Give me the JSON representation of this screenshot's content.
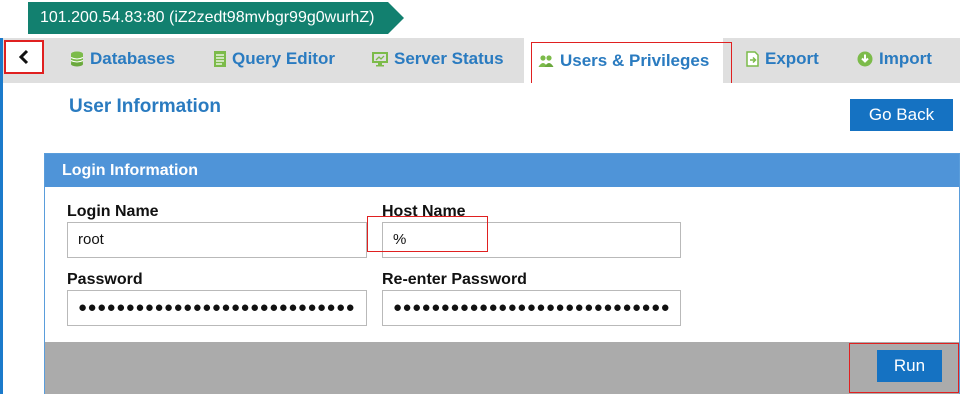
{
  "connection": {
    "label": "101.200.54.83:80 (iZ2zedt98mvbgr99g0wurhZ)"
  },
  "tabs": [
    {
      "label": "Databases",
      "icon": "database-icon"
    },
    {
      "label": "Query Editor",
      "icon": "query-editor-icon"
    },
    {
      "label": "Server Status",
      "icon": "monitor-icon"
    },
    {
      "label": "Users & Privileges",
      "icon": "users-icon",
      "active": true
    },
    {
      "label": "Export",
      "icon": "export-icon"
    },
    {
      "label": "Import",
      "icon": "import-icon"
    }
  ],
  "page": {
    "title": "User Information",
    "go_back_label": "Go Back"
  },
  "login_panel": {
    "title": "Login Information",
    "login_name_label": "Login Name",
    "login_name_value": "root",
    "host_name_label": "Host Name",
    "host_name_value": "%",
    "password_label": "Password",
    "password_value": "●●●●●●●●●●●●●●●●●●●●●●●●●●●●●",
    "reenter_password_label": "Re-enter Password",
    "reenter_password_value": "●●●●●●●●●●●●●●●●●●●●●●●●●●●●●",
    "run_label": "Run"
  },
  "colors": {
    "accent_blue": "#2a7bc0",
    "button_blue": "#1572c2",
    "connection_green": "#12806f",
    "panel_header": "#4f94d8",
    "highlight_red": "#e02020"
  }
}
